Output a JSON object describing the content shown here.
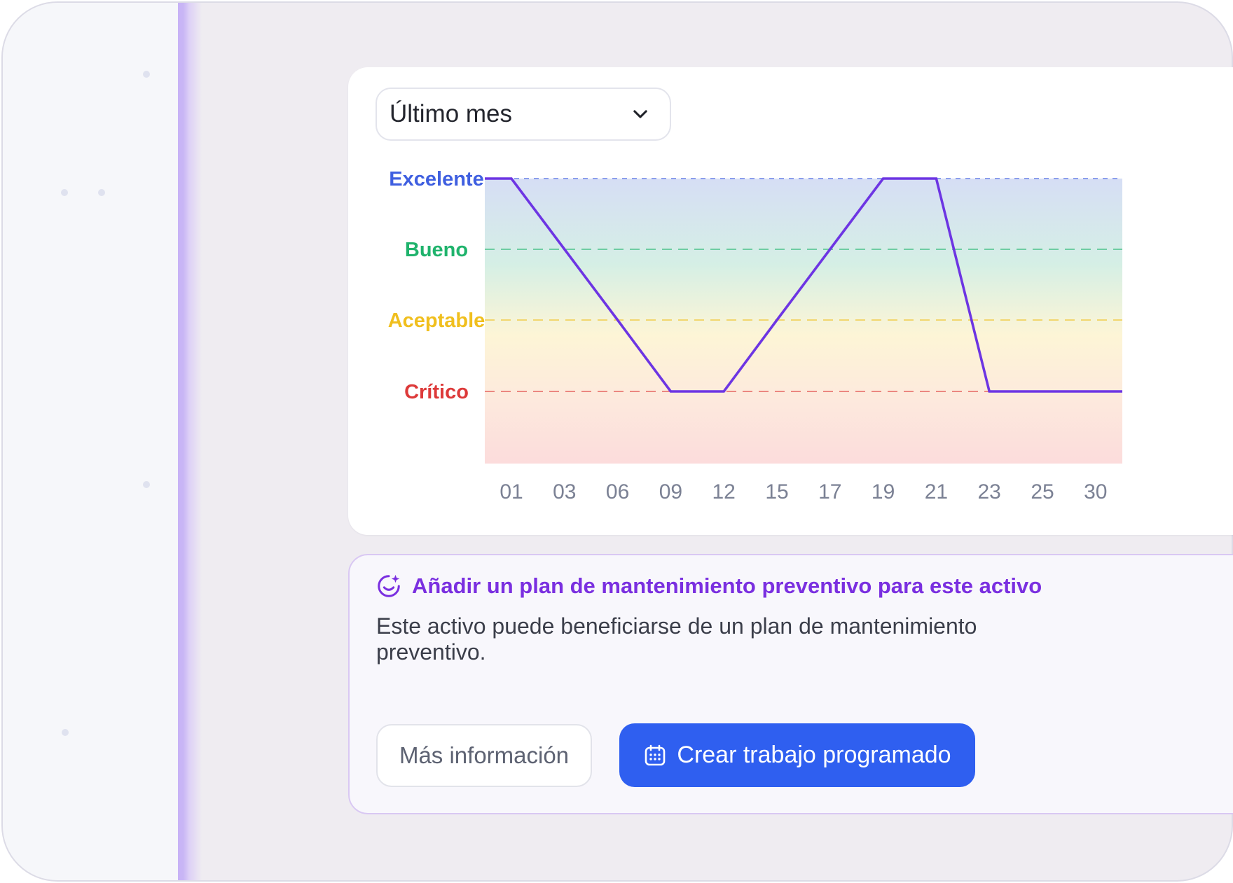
{
  "filter": {
    "selected": "Último mes"
  },
  "chart_data": {
    "type": "line",
    "y_categories": [
      "Excelente",
      "Bueno",
      "Aceptable",
      "Crítico"
    ],
    "y_colors": {
      "Excelente": "#3f5fe0",
      "Bueno": "#1fb36c",
      "Aceptable": "#f0bf1e",
      "Crítico": "#dd3a3a"
    },
    "x": [
      "01",
      "03",
      "06",
      "09",
      "12",
      "15",
      "17",
      "19",
      "21",
      "23",
      "25",
      "30"
    ],
    "values": [
      "Excelente",
      "Bueno",
      "Aceptable",
      "Crítico",
      "Crítico",
      "Aceptable",
      "Bueno",
      "Excelente",
      "Excelente",
      "Crítico",
      "Crítico",
      "Crítico"
    ],
    "line_color": "#6d35e3",
    "grid": true
  },
  "promo": {
    "icon": "sparkle-smile-icon",
    "title": "Añadir un plan de mantenimiento preventivo para este activo",
    "body": "Este activo puede beneficiarse de un plan de mantenimiento preventivo.",
    "more_button": "Más información",
    "create_button": "Crear trabajo programado",
    "create_icon": "calendar-icon"
  },
  "colors": {
    "accent": "#7a2fe0",
    "primary_button": "#2f5ff0"
  }
}
